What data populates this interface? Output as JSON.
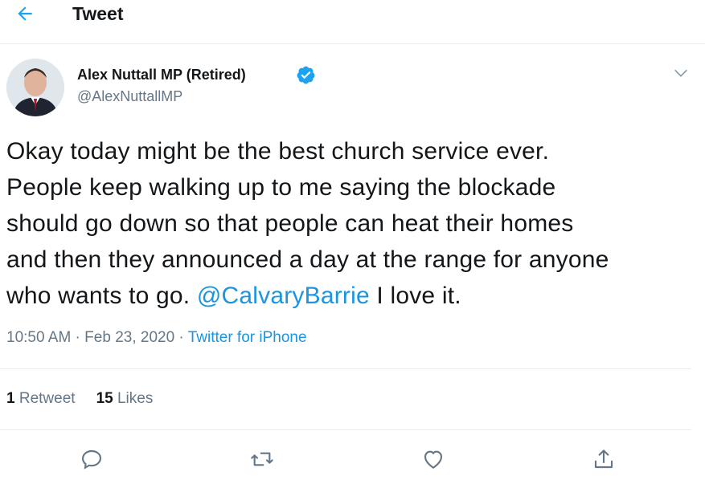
{
  "header": {
    "title": "Tweet",
    "back_icon": "arrow-left-icon"
  },
  "author": {
    "display_name": "Alex Nuttall MP (Retired)",
    "handle": "@AlexNuttallMP",
    "verified": true,
    "verified_icon": "verified-badge-icon"
  },
  "tweet": {
    "text_lines": [
      "Okay today might be the best church service ever.",
      "People keep walking up to me saying the blockade",
      "should go down so that people can heat their homes",
      "and then they announced a day at the range for anyone",
      "who wants to go."
    ],
    "mention": "@CalvaryBarrie",
    "text_after_mention": " I love it."
  },
  "meta": {
    "time": "10:50 AM",
    "separator": " · ",
    "date": "Feb 23, 2020",
    "source": "Twitter for iPhone"
  },
  "stats": {
    "retweets_count": "1",
    "retweets_label": "Retweet",
    "likes_count": "15",
    "likes_label": "Likes"
  },
  "actions": [
    "reply-icon",
    "retweet-icon",
    "like-icon",
    "share-icon"
  ],
  "colors": {
    "link": "#1b95e0",
    "muted": "#657786",
    "divider": "#e6ecf0",
    "verified": "#1da1f2"
  }
}
